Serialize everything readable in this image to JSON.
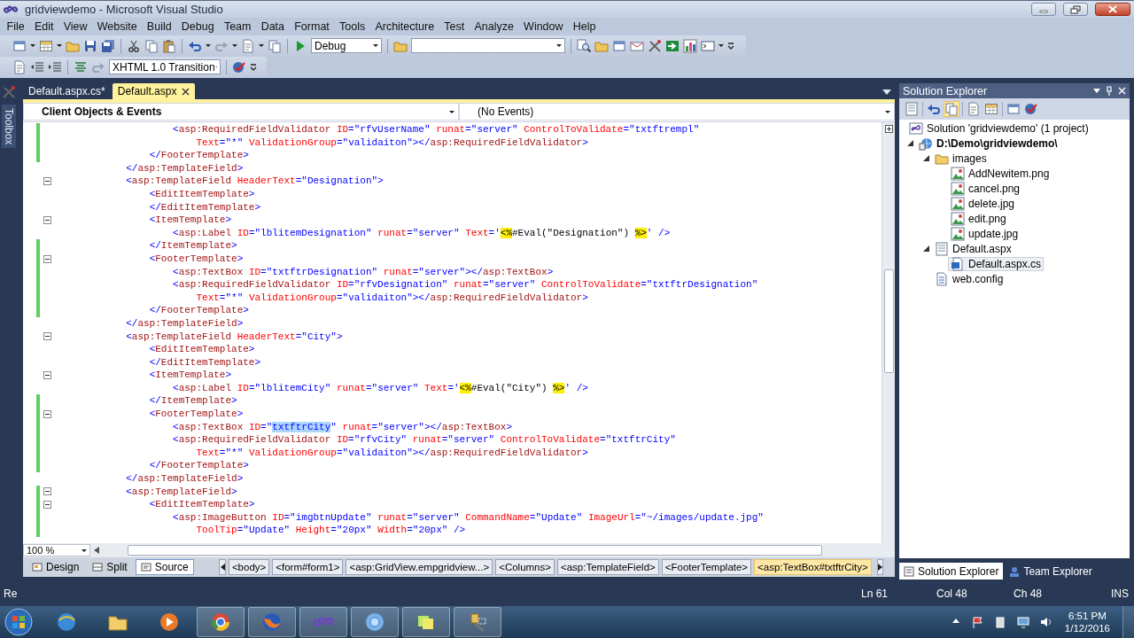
{
  "window": {
    "title": "gridviewdemo - Microsoft Visual Studio"
  },
  "menu": [
    "File",
    "Edit",
    "View",
    "Website",
    "Build",
    "Debug",
    "Team",
    "Data",
    "Format",
    "Tools",
    "Architecture",
    "Test",
    "Analyze",
    "Window",
    "Help"
  ],
  "toolbar": {
    "configuration": "Debug",
    "target_schema": "XHTML 1.0 Transition"
  },
  "toolbox": {
    "label": "Toolbox"
  },
  "documents": {
    "tabs": [
      {
        "label": "Default.aspx.cs*",
        "selected": false
      },
      {
        "label": "Default.aspx",
        "selected": true
      }
    ],
    "navigation": {
      "objects": "Client Objects & Events",
      "events": "(No Events)"
    },
    "lines": [
      {
        "changed": true,
        "fold": false,
        "parts": [
          {
            "kind": "markup",
            "text": "                    <asp:RequiredFieldValidator ID=\"rfvUserName\" runat=\"server\" ControlToValidate=\"txtftrempl\""
          }
        ]
      },
      {
        "changed": true,
        "fold": false,
        "parts": [
          {
            "kind": "markup",
            "text": "                        Text=\"*\" ValidationGroup=\"validaiton\"></asp:RequiredFieldValidator>"
          }
        ]
      },
      {
        "changed": true,
        "fold": false,
        "parts": [
          {
            "kind": "markup",
            "text": "                </FooterTemplate>"
          }
        ]
      },
      {
        "changed": false,
        "fold": false,
        "parts": [
          {
            "kind": "markup",
            "text": "            </asp:TemplateField>"
          }
        ]
      },
      {
        "changed": false,
        "fold": true,
        "parts": [
          {
            "kind": "markup",
            "text": "            <asp:TemplateField HeaderText=\"Designation\">"
          }
        ]
      },
      {
        "changed": false,
        "fold": false,
        "parts": [
          {
            "kind": "markup",
            "text": "                <EditItemTemplate>"
          }
        ]
      },
      {
        "changed": false,
        "fold": false,
        "parts": [
          {
            "kind": "markup",
            "text": "                </EditItemTemplate>"
          }
        ]
      },
      {
        "changed": false,
        "fold": true,
        "parts": [
          {
            "kind": "markup",
            "text": "                <ItemTemplate>"
          }
        ]
      },
      {
        "changed": false,
        "fold": false,
        "parts": [
          {
            "kind": "markup",
            "text": "                    <asp:Label ID=\"lblitemDesignation\" runat=\"server\" Text='"
          },
          {
            "kind": "delimiter",
            "text": "<%"
          },
          {
            "kind": "script",
            "text": "#Eval(\"Designation\") "
          },
          {
            "kind": "delimiter",
            "text": "%>"
          },
          {
            "kind": "markup",
            "text": "' />"
          }
        ]
      },
      {
        "changed": true,
        "fold": false,
        "parts": [
          {
            "kind": "markup",
            "text": "                </ItemTemplate>"
          }
        ]
      },
      {
        "changed": true,
        "fold": true,
        "parts": [
          {
            "kind": "markup",
            "text": "                <FooterTemplate>"
          }
        ]
      },
      {
        "changed": true,
        "fold": false,
        "parts": [
          {
            "kind": "markup",
            "text": "                    <asp:TextBox ID=\"txtftrDesignation\" runat=\"server\"></asp:TextBox>"
          }
        ]
      },
      {
        "changed": true,
        "fold": false,
        "parts": [
          {
            "kind": "markup",
            "text": "                    <asp:RequiredFieldValidator ID=\"rfvDesignation\" runat=\"server\" ControlToValidate=\"txtftrDesignation\""
          }
        ]
      },
      {
        "changed": true,
        "fold": false,
        "parts": [
          {
            "kind": "markup",
            "text": "                        Text=\"*\" ValidationGroup=\"validaiton\"></asp:RequiredFieldValidator>"
          }
        ]
      },
      {
        "changed": true,
        "fold": false,
        "parts": [
          {
            "kind": "markup",
            "text": "                </FooterTemplate>"
          }
        ]
      },
      {
        "changed": false,
        "fold": false,
        "parts": [
          {
            "kind": "markup",
            "text": "            </asp:TemplateField>"
          }
        ]
      },
      {
        "changed": false,
        "fold": true,
        "parts": [
          {
            "kind": "markup",
            "text": "            <asp:TemplateField HeaderText=\"City\">"
          }
        ]
      },
      {
        "changed": false,
        "fold": false,
        "parts": [
          {
            "kind": "markup",
            "text": "                <EditItemTemplate>"
          }
        ]
      },
      {
        "changed": false,
        "fold": false,
        "parts": [
          {
            "kind": "markup",
            "text": "                </EditItemTemplate>"
          }
        ]
      },
      {
        "changed": false,
        "fold": true,
        "parts": [
          {
            "kind": "markup",
            "text": "                <ItemTemplate>"
          }
        ]
      },
      {
        "changed": false,
        "fold": false,
        "parts": [
          {
            "kind": "markup",
            "text": "                    <asp:Label ID=\"lblitemCity\" runat=\"server\" Text='"
          },
          {
            "kind": "delimiter",
            "text": "<%"
          },
          {
            "kind": "script",
            "text": "#Eval(\"City\") "
          },
          {
            "kind": "delimiter",
            "text": "%>"
          },
          {
            "kind": "markup",
            "text": "' />"
          }
        ]
      },
      {
        "changed": true,
        "fold": false,
        "parts": [
          {
            "kind": "markup",
            "text": "                </ItemTemplate>"
          }
        ]
      },
      {
        "changed": true,
        "fold": true,
        "parts": [
          {
            "kind": "markup",
            "text": "                <FooterTemplate>"
          }
        ]
      },
      {
        "changed": true,
        "fold": false,
        "parts": [
          {
            "kind": "markup",
            "text": "                    <asp:TextBox ID=\""
          },
          {
            "kind": "selection",
            "text": "txtftrCity"
          },
          {
            "kind": "markup",
            "text": "\" runat=\"server\"></asp:TextBox>"
          }
        ]
      },
      {
        "changed": true,
        "fold": false,
        "parts": [
          {
            "kind": "markup",
            "text": "                    <asp:RequiredFieldValidator ID=\"rfvCity\" runat=\"server\" ControlToValidate=\"txtftrCity\""
          }
        ]
      },
      {
        "changed": true,
        "fold": false,
        "parts": [
          {
            "kind": "markup",
            "text": "                        Text=\"*\" ValidationGroup=\"validaiton\"></asp:RequiredFieldValidator>"
          }
        ]
      },
      {
        "changed": true,
        "fold": false,
        "parts": [
          {
            "kind": "markup",
            "text": "                </FooterTemplate>"
          }
        ]
      },
      {
        "changed": false,
        "fold": false,
        "parts": [
          {
            "kind": "markup",
            "text": "            </asp:TemplateField>"
          }
        ]
      },
      {
        "changed": true,
        "fold": true,
        "parts": [
          {
            "kind": "markup",
            "text": "            <asp:TemplateField>"
          }
        ]
      },
      {
        "changed": true,
        "fold": true,
        "parts": [
          {
            "kind": "markup",
            "text": "                <EditItemTemplate>"
          }
        ]
      },
      {
        "changed": true,
        "fold": false,
        "parts": [
          {
            "kind": "markup",
            "text": "                    <asp:ImageButton ID=\"imgbtnUpdate\" runat=\"server\" CommandName=\"Update\" ImageUrl=\"~/images/update.jpg\""
          }
        ]
      },
      {
        "changed": true,
        "fold": false,
        "parts": [
          {
            "kind": "markup",
            "text": "                        ToolTip=\"Update\" Height=\"20px\" Width=\"20px\" />"
          }
        ]
      }
    ],
    "zoom": "100 %",
    "views": [
      {
        "label": "Design",
        "kind": "design",
        "selected": false
      },
      {
        "label": "Split",
        "kind": "split",
        "selected": false
      },
      {
        "label": "Source",
        "kind": "source",
        "selected": true
      }
    ],
    "breadcrumbs": [
      {
        "label": "<body>",
        "selected": false
      },
      {
        "label": "<form#form1>",
        "selected": false
      },
      {
        "label": "<asp:GridView.empgridview...>",
        "selected": false
      },
      {
        "label": "<Columns>",
        "selected": false
      },
      {
        "label": "<asp:TemplateField>",
        "selected": false
      },
      {
        "label": "<FooterTemplate>",
        "selected": false
      },
      {
        "label": "<asp:TextBox#txtftrCity>",
        "selected": true
      }
    ]
  },
  "solution_explorer": {
    "title": "Solution Explorer",
    "tree": [
      {
        "label": "Solution 'gridviewdemo' (1 project)",
        "kind": "solution",
        "selected": false,
        "children": [
          {
            "label": "D:\\Demo\\gridviewdemo\\",
            "kind": "project",
            "selected": false,
            "expanded": true,
            "children": [
              {
                "label": "images",
                "kind": "folder",
                "selected": false,
                "expanded": true,
                "children": [
                  {
                    "label": "AddNewitem.png",
                    "kind": "image",
                    "selected": false
                  },
                  {
                    "label": "cancel.png",
                    "kind": "image",
                    "selected": false
                  },
                  {
                    "label": "delete.jpg",
                    "kind": "image",
                    "selected": false
                  },
                  {
                    "label": "edit.png",
                    "kind": "image",
                    "selected": false
                  },
                  {
                    "label": "update.jpg",
                    "kind": "image",
                    "selected": false
                  }
                ]
              },
              {
                "label": "Default.aspx",
                "kind": "page",
                "selected": false,
                "expanded": true,
                "children": [
                  {
                    "label": "Default.aspx.cs",
                    "kind": "code",
                    "selected": true
                  }
                ]
              },
              {
                "label": "web.config",
                "kind": "config",
                "selected": false
              }
            ]
          }
        ]
      }
    ],
    "tabs": [
      {
        "label": "Solution Explorer",
        "selected": true
      },
      {
        "label": "Team Explorer",
        "selected": false
      }
    ]
  },
  "status_bar": {
    "message": "Re",
    "line": "Ln 61",
    "column": "Col 48",
    "char": "Ch 48",
    "mode": "INS"
  },
  "taskbar": {
    "time": "6:51 PM",
    "date": "1/12/2016"
  }
}
